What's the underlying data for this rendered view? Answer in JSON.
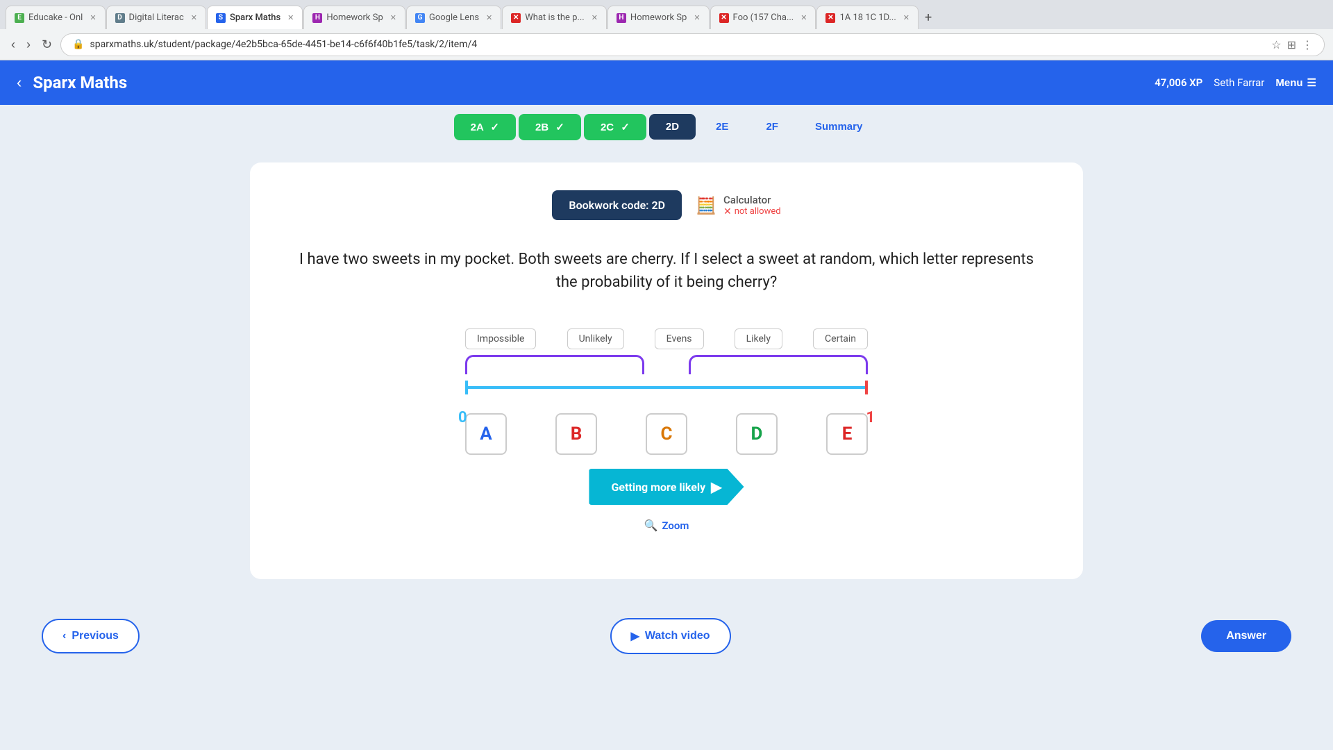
{
  "browser": {
    "url": "sparxmaths.uk/student/package/4e2b5bca-65de-4451-be14-c6f6f40b1fe5/task/2/item/4",
    "tabs": [
      {
        "label": "Educake - Onl",
        "active": false,
        "favicon": "E"
      },
      {
        "label": "Digital Literac",
        "active": false,
        "favicon": "D"
      },
      {
        "label": "Sparx Maths",
        "active": true,
        "favicon": "S"
      },
      {
        "label": "Homework Sp",
        "active": false,
        "favicon": "H"
      },
      {
        "label": "Google Lens",
        "active": false,
        "favicon": "G"
      },
      {
        "label": "What is the p...",
        "active": false,
        "favicon": "X"
      },
      {
        "label": "Homework Sp",
        "active": false,
        "favicon": "H"
      },
      {
        "label": "Foo (157 Cha...",
        "active": false,
        "favicon": "X"
      },
      {
        "label": "1A 18 1C 1D...",
        "active": false,
        "favicon": "X"
      }
    ]
  },
  "header": {
    "logo": "Sparx Maths",
    "xp": "47,006 XP",
    "user": "Seth Farrar",
    "menu": "Menu"
  },
  "tabs": [
    {
      "id": "2A",
      "label": "2A",
      "state": "done"
    },
    {
      "id": "2B",
      "label": "2B",
      "state": "done"
    },
    {
      "id": "2C",
      "label": "2C",
      "state": "done"
    },
    {
      "id": "2D",
      "label": "2D",
      "state": "active"
    },
    {
      "id": "2E",
      "label": "2E",
      "state": "upcoming"
    },
    {
      "id": "2F",
      "label": "2F",
      "state": "upcoming"
    },
    {
      "id": "summary",
      "label": "Summary",
      "state": "summary"
    }
  ],
  "question": {
    "bookwork_code": "Bookwork code: 2D",
    "calculator_label": "Calculator",
    "calculator_status": "not allowed",
    "text": "I have two sweets in my pocket. Both sweets are cherry. If I select a sweet at random, which letter represents the probability of it being cherry?",
    "diagram": {
      "labels": [
        "Impossible",
        "Unlikely",
        "Evens",
        "Likely",
        "Certain"
      ],
      "num_start": "0",
      "num_end": "1",
      "letters": [
        {
          "letter": "A",
          "color": "letter-A"
        },
        {
          "letter": "B",
          "color": "letter-B"
        },
        {
          "letter": "C",
          "color": "letter-C"
        },
        {
          "letter": "D",
          "color": "letter-D"
        },
        {
          "letter": "E",
          "color": "letter-E"
        }
      ],
      "arrow_text": "Getting more likely"
    },
    "zoom_label": "Zoom"
  },
  "buttons": {
    "previous": "Previous",
    "watch_video": "Watch video",
    "answer": "Answer"
  }
}
